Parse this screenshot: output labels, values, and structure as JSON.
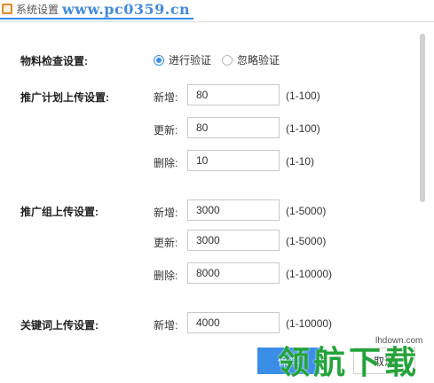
{
  "tabbar": {
    "active_tab": "系统设置",
    "watermark": "www.pc0359.cn"
  },
  "material_check": {
    "label": "物料检查设置:",
    "options": [
      {
        "label": "进行验证",
        "checked": true
      },
      {
        "label": "忽略验证",
        "checked": false
      }
    ]
  },
  "sections": [
    {
      "label": "推广计划上传设置:",
      "fields": [
        {
          "label": "新增:",
          "value": "80",
          "range": "(1-100)"
        },
        {
          "label": "更新:",
          "value": "80",
          "range": "(1-100)"
        },
        {
          "label": "删除:",
          "value": "10",
          "range": "(1-10)"
        }
      ]
    },
    {
      "label": "推广组上传设置:",
      "fields": [
        {
          "label": "新增:",
          "value": "3000",
          "range": "(1-5000)"
        },
        {
          "label": "更新:",
          "value": "3000",
          "range": "(1-5000)"
        },
        {
          "label": "删除:",
          "value": "8000",
          "range": "(1-10000)"
        }
      ]
    },
    {
      "label": "关键词上传设置:",
      "fields": [
        {
          "label": "新增:",
          "value": "4000",
          "range": "(1-10000)"
        }
      ]
    }
  ],
  "buttons": {
    "save": "保存",
    "cancel": "取消"
  },
  "site_watermark": {
    "text": "领航下载",
    "url": "lhdown.com"
  },
  "colors": {
    "accent": "#3a8ee6",
    "watermark_green": "#23a33a"
  }
}
